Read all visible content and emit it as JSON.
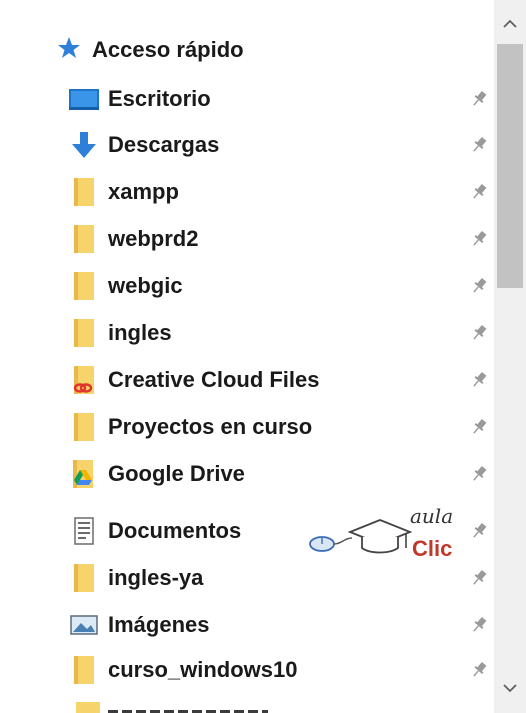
{
  "quick_access": {
    "label": "Acceso rápido",
    "icon": "quick-access-star-icon"
  },
  "items": [
    {
      "label": "Escritorio",
      "icon": "desktop-icon"
    },
    {
      "label": "Descargas",
      "icon": "download-arrow-icon"
    },
    {
      "label": "xampp",
      "icon": "folder-icon"
    },
    {
      "label": "webprd2",
      "icon": "folder-icon"
    },
    {
      "label": "webgic",
      "icon": "folder-icon"
    },
    {
      "label": "ingles",
      "icon": "folder-icon"
    },
    {
      "label": "Creative Cloud Files",
      "icon": "creative-cloud-folder-icon"
    },
    {
      "label": "Proyectos en curso",
      "icon": "folder-icon"
    },
    {
      "label": "Google Drive",
      "icon": "google-drive-folder-icon"
    },
    {
      "label": "Documentos",
      "icon": "documents-icon"
    },
    {
      "label": "ingles-ya",
      "icon": "folder-icon"
    },
    {
      "label": "Imágenes",
      "icon": "pictures-icon"
    },
    {
      "label": "curso_windows10",
      "icon": "folder-icon"
    }
  ],
  "watermark": {
    "line1": "aula",
    "line2": "Clic"
  },
  "colors": {
    "folder": "#f6d46b",
    "accent_blue": "#2d7fd8",
    "creative_cloud_red": "#e0332b",
    "scroll_thumb": "#c2c2c2"
  }
}
